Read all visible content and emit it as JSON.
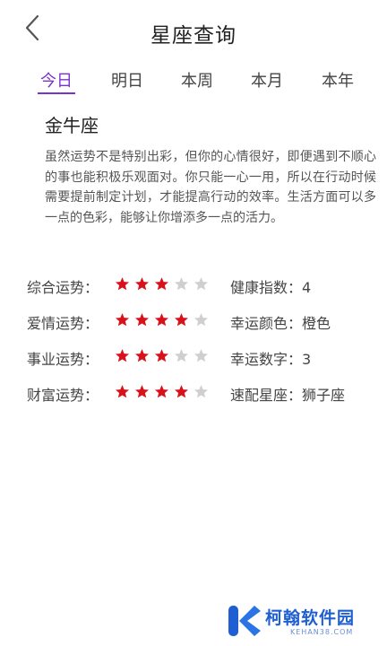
{
  "header": {
    "title": "星座查询",
    "back_icon": "chevron-left-icon"
  },
  "tabs": [
    {
      "label": "今日",
      "active": true
    },
    {
      "label": "明日",
      "active": false
    },
    {
      "label": "本周",
      "active": false
    },
    {
      "label": "本月",
      "active": false
    },
    {
      "label": "本年",
      "active": false
    }
  ],
  "sign": {
    "name": "金牛座",
    "description": "虽然运势不是特别出彩，但你的心情很好，即便遇到不顺心的事也能积极乐观面对。你只能一心一用，所以在行动时候需要提前制定计划，才能提高行动的效率。生活方面可以多一点的色彩，能够让你增添多一点的活力。"
  },
  "fortunes": [
    {
      "label": "综合运势：",
      "stars": 3,
      "max": 5,
      "info": "健康指数：4"
    },
    {
      "label": "爱情运势：",
      "stars": 4,
      "max": 5,
      "info": "幸运颜色：橙色"
    },
    {
      "label": "事业运势：",
      "stars": 3,
      "max": 5,
      "info": "幸运数字：3"
    },
    {
      "label": "财富运势：",
      "stars": 4,
      "max": 5,
      "info": "速配星座：狮子座"
    }
  ],
  "watermark": {
    "text": "柯翰软件园",
    "url": "KEHAN38.COM"
  },
  "colors": {
    "accent": "#7a34c9",
    "star_on": "#d9111b",
    "star_off": "#cfcfcf",
    "watermark": "#1f5fd1"
  }
}
